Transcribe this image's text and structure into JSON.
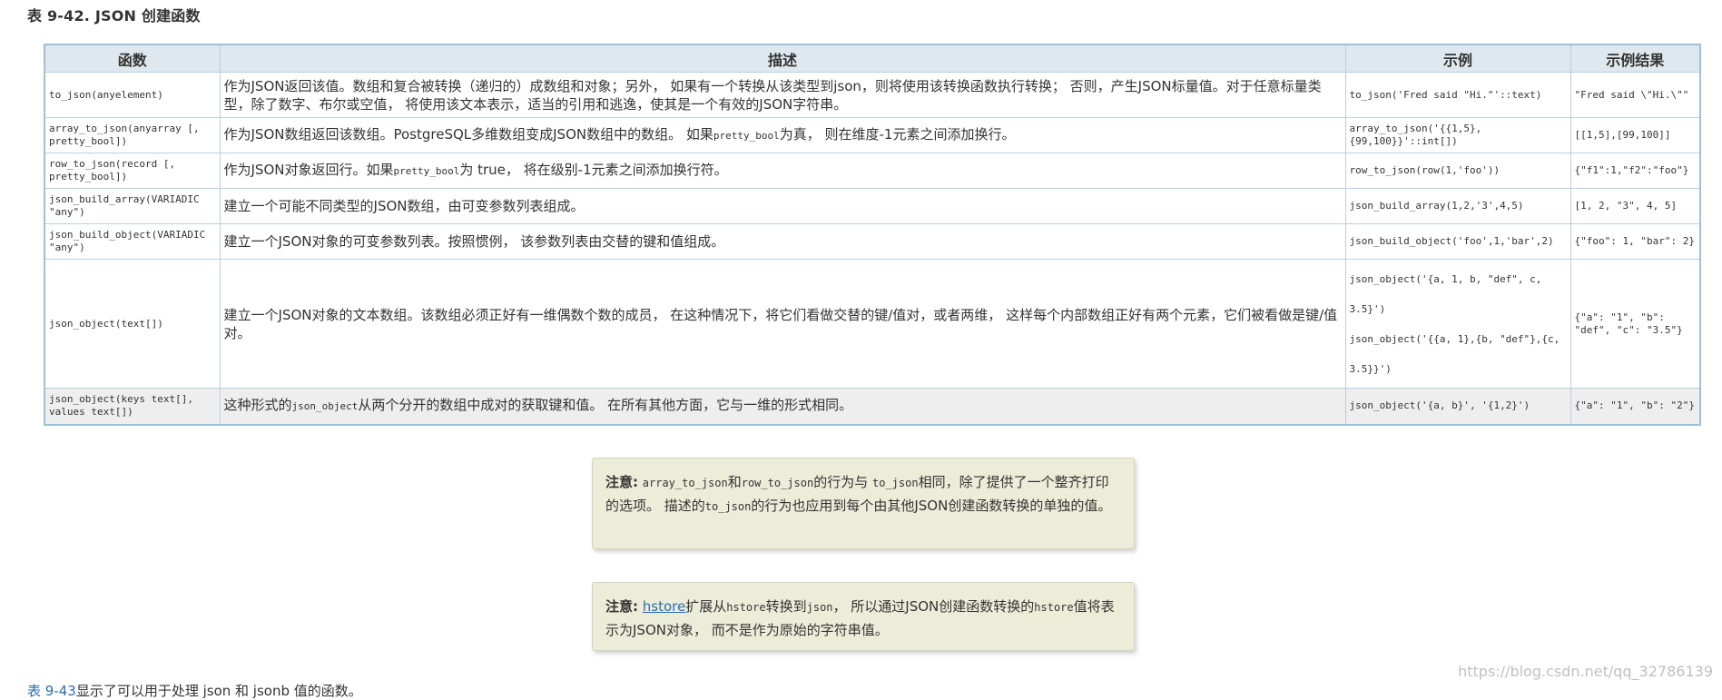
{
  "caption": "表 9-42. JSON 创建函数",
  "table": {
    "headers": [
      "函数",
      "描述",
      "示例",
      "示例结果"
    ],
    "rows": [
      {
        "func": "to_json(anyelement)",
        "desc": "作为JSON返回该值。数组和复合被转换（递归的）成数组和对象；另外， 如果有一个转换从该类型到json，则将使用该转换函数执行转换； 否则，产生JSON标量值。对于任意标量类型，除了数字、布尔或空值， 将使用该文本表示，适当的引用和逃逸，使其是一个有效的JSON字符串。",
        "example": "to_json('Fred said \"Hi.\"'::text)",
        "result": "\"Fred said \\\"Hi.\\\"\""
      },
      {
        "func": "array_to_json(anyarray [, pretty_bool])",
        "desc_a": "作为JSON数组返回该数组。PostgreSQL多维数组变成JSON数组中的数组。 如果",
        "desc_code": "pretty_bool",
        "desc_b": "为真， 则在维度-1元素之间添加换行。",
        "example": "array_to_json('{{1,5},{99,100}}'::int[])",
        "result": "[[1,5],[99,100]]"
      },
      {
        "func": "row_to_json(record [, pretty_bool])",
        "desc_a": "作为JSON对象返回行。如果",
        "desc_code": "pretty_bool",
        "desc_b": "为 true， 将在级别-1元素之间添加换行符。",
        "example": "row_to_json(row(1,'foo'))",
        "result": "{\"f1\":1,\"f2\":\"foo\"}"
      },
      {
        "func": "json_build_array(VARIADIC \"any\")",
        "desc": "建立一个可能不同类型的JSON数组，由可变参数列表组成。",
        "example": "json_build_array(1,2,'3',4,5)",
        "result": "[1, 2, \"3\", 4, 5]"
      },
      {
        "func": "json_build_object(VARIADIC \"any\")",
        "desc": "建立一个JSON对象的可变参数列表。按照惯例， 该参数列表由交替的键和值组成。",
        "example": "json_build_object('foo',1,'bar',2)",
        "result": "{\"foo\": 1, \"bar\": 2}"
      },
      {
        "func": "json_object(text[])",
        "desc": "建立一个JSON对象的文本数组。该数组必须正好有一维偶数个数的成员， 在这种情况下，将它们看做交替的键/值对，或者两维， 这样每个内部数组正好有两个元素，它们被看做是键/值对。",
        "example_1": "json_object('{a, 1, b, \"def\", c, 3.5}')",
        "example_2": "json_object('{{a, 1},{b, \"def\"},{c, 3.5}}')",
        "result": "{\"a\": \"1\", \"b\": \"def\", \"c\": \"3.5\"}"
      },
      {
        "func": "json_object(keys text[], values text[])",
        "desc_a": "这种形式的",
        "desc_code": "json_object",
        "desc_b": "从两个分开的数组中成对的获取键和值。 在所有其他方面，它与一维的形式相同。",
        "example": "json_object('{a, b}', '{1,2}')",
        "result": "{\"a\": \"1\", \"b\": \"2\"}"
      }
    ]
  },
  "note1": {
    "label": "注意:",
    "code1": "array_to_json",
    "t1": "和",
    "code2": "row_to_json",
    "t2": "的行为与",
    "code3": "to_json",
    "t3": "相同，除了提供了一个整齐打印的选项。 描述的",
    "code4": "to_json",
    "t4": "的行为也应用到每个由其他JSON创建函数转换的单独的值。"
  },
  "note2": {
    "label": "注意:",
    "link": "hstore",
    "t1": "扩展从",
    "code1": "hstore",
    "t2": "转换到",
    "code2": "json",
    "t3": "， 所以通过JSON创建函数转换的",
    "code3": "hstore",
    "t4": "值将表示为JSON对象， 而不是作为原始的字符串值。"
  },
  "watermark": "https://blog.csdn.net/qq_32786139",
  "bottom_partial": {
    "link": "表 9-43",
    "text": "显示了可以用于处理 json 和 jsonb 值的函数。"
  }
}
